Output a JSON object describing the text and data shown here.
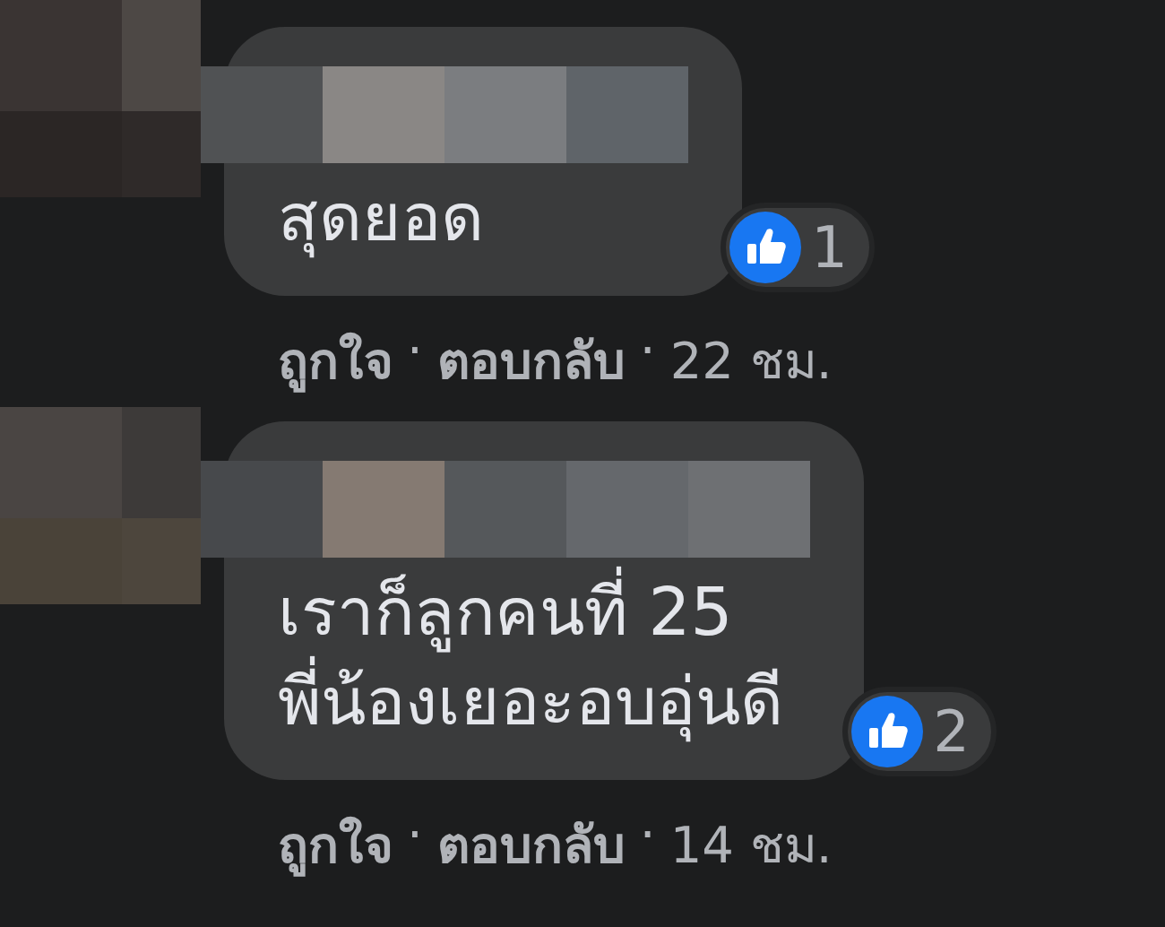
{
  "comments": [
    {
      "lines": [
        "สุดยอด"
      ],
      "likes": "1",
      "actions": [
        {
          "kind": "link",
          "text": "ถูกใจ"
        },
        {
          "kind": "dot",
          "text": "·"
        },
        {
          "kind": "link",
          "text": "ตอบกลับ"
        },
        {
          "kind": "dot",
          "text": "·"
        },
        {
          "kind": "time",
          "text": "22 ชม."
        }
      ]
    },
    {
      "lines": [
        "เราก็ลูกคนที่ 25",
        "พี่น้องเยอะอบอุ่นดี"
      ],
      "likes": "2",
      "actions": [
        {
          "kind": "link",
          "text": "ถูกใจ"
        },
        {
          "kind": "dot",
          "text": "·"
        },
        {
          "kind": "link",
          "text": "ตอบกลับ"
        },
        {
          "kind": "dot",
          "text": "·"
        },
        {
          "kind": "time",
          "text": "14 ชม."
        }
      ]
    }
  ]
}
